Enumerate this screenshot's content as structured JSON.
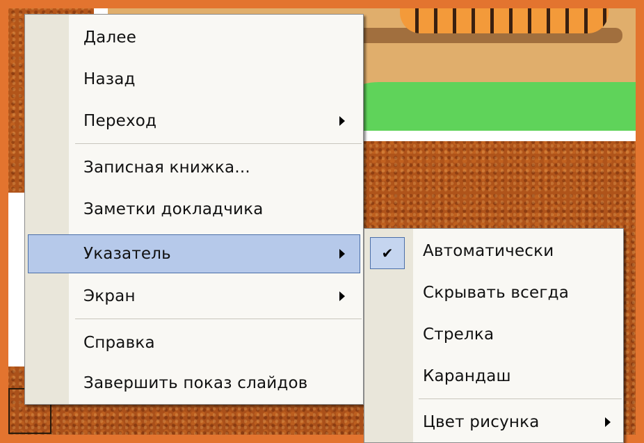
{
  "main_menu": {
    "items": [
      {
        "label": "Далее",
        "has_submenu": false
      },
      {
        "label": "Назад",
        "has_submenu": false
      },
      {
        "label": "Переход",
        "has_submenu": true
      },
      {
        "label": "Записная книжка...",
        "has_submenu": false
      },
      {
        "label": "Заметки докладчика",
        "has_submenu": false
      },
      {
        "label": "Указатель",
        "has_submenu": true,
        "selected": true
      },
      {
        "label": "Экран",
        "has_submenu": true
      },
      {
        "label": "Справка",
        "has_submenu": false
      },
      {
        "label": "Завершить показ слайдов",
        "has_submenu": false
      }
    ]
  },
  "sub_menu": {
    "items": [
      {
        "label": "Автоматически",
        "checked": true
      },
      {
        "label": "Скрывать всегда"
      },
      {
        "label": "Стрелка"
      },
      {
        "label": "Карандаш"
      },
      {
        "label": "Цвет рисунка",
        "has_submenu": true
      }
    ],
    "check_glyph": "✔"
  },
  "colors": {
    "selection_fill": "#b6c9ea",
    "selection_border": "#4a6ea8",
    "menu_background": "#f9f8f4",
    "gutter": "#e9e6da",
    "slide_frame": "#e3742f"
  },
  "icons": {
    "submenu_arrow": "chevron-right-icon",
    "checkmark": "check-icon"
  }
}
